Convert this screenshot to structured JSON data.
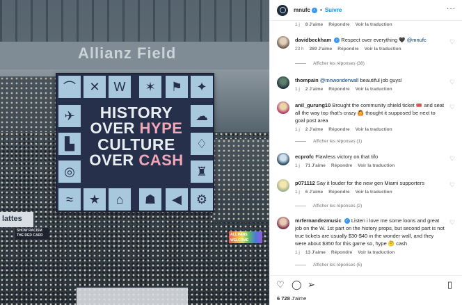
{
  "header": {
    "username": "mnufc",
    "follow_label": "Suivre"
  },
  "top_meta": {
    "age": "1 j",
    "likes": "8 J'aime",
    "reply": "Répondre",
    "translate": "Voir la traduction"
  },
  "comments": [
    {
      "username": "davidbeckham",
      "verified": true,
      "text_pre": "Respect over everything 🖤 ",
      "mention": "@mnufc",
      "text_post": "",
      "age": "23 h",
      "likes": "269 J'aime",
      "reply": "Répondre",
      "translate": "Voir la traduction",
      "replies": "Afficher les réponses (38)"
    },
    {
      "username": "thompain",
      "verified": false,
      "text_pre": "",
      "mention": "@mnwonderwall",
      "text_post": " beautiful job guys!",
      "age": "1 j",
      "likes": "2 J'aime",
      "reply": "Répondre",
      "translate": "Voir la traduction",
      "replies": ""
    },
    {
      "username": "anil_gurung10",
      "verified": false,
      "text_pre": "Brought the community shield ticket 🎟️ and seat all the way top that's crazy 🙆 thought it supposed be next to goal post area",
      "mention": "",
      "text_post": "",
      "age": "1 j",
      "likes": "2 J'aime",
      "reply": "Répondre",
      "translate": "Voir la traduction",
      "replies": "Afficher les réponses (1)"
    },
    {
      "username": "ecprofc",
      "verified": false,
      "text_pre": "Flawless victory on that tifo",
      "mention": "",
      "text_post": "",
      "age": "1 j",
      "likes": "71 J'aime",
      "reply": "Répondre",
      "translate": "Voir la traduction",
      "replies": ""
    },
    {
      "username": "p071112",
      "verified": false,
      "text_pre": "Say it louder for the new gen Miami supporters",
      "mention": "",
      "text_post": "",
      "age": "1 j",
      "likes": "6 J'aime",
      "reply": "Répondre",
      "translate": "Voir la traduction",
      "replies": "Afficher les réponses (2)"
    },
    {
      "username": "mrfernandezmusic",
      "verified": true,
      "text_pre": "Listen i love me some loons and great job on the W. 1st part on the history props, but second part is not true tickets are usually $30-$40 in the wonder wall, and they were about $350 for this game so, hype 🤔 cash",
      "mention": "",
      "text_post": "",
      "age": "1 j",
      "likes": "13 J'aime",
      "reply": "Répondre",
      "translate": "Voir la traduction",
      "replies": "Afficher les réponses (5)"
    }
  ],
  "footer": {
    "likes": "6 728",
    "likes_suffix": " J'aime"
  },
  "photo": {
    "stadium": "Allianz Field",
    "tifo_line1": "HISTORY",
    "tifo_over1": "OVER ",
    "tifo_hype": "HYPE",
    "tifo_line3": "CULTURE",
    "tifo_over2": "OVER ",
    "tifo_cash": "CASH",
    "sign_left": "lattes",
    "sign_racism": "SHOW RACISM THE RED CARD",
    "sign_pride": "ALL PANS WELCOME"
  },
  "icons": [
    "heart-icon",
    "comment-icon",
    "share-icon",
    "bookmark-icon",
    "more-icon"
  ]
}
